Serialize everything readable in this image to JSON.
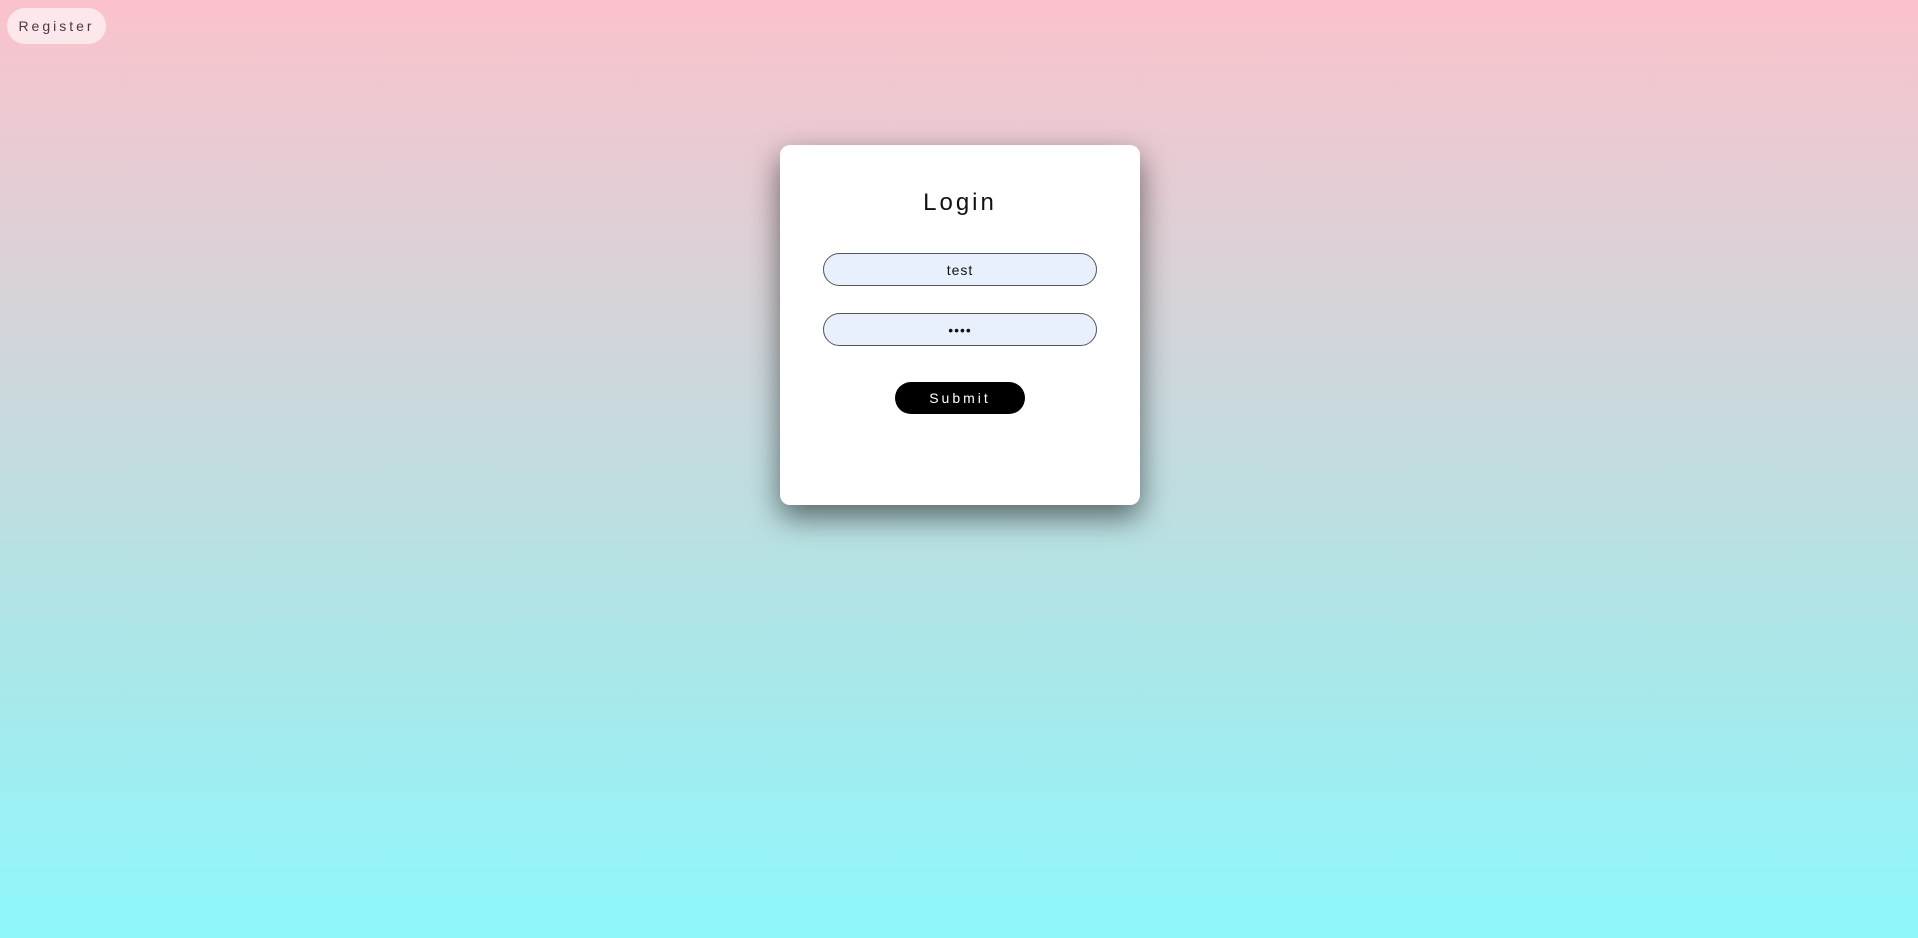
{
  "header": {
    "register_label": "Register"
  },
  "login": {
    "title": "Login",
    "username_value": "test",
    "password_value": "test",
    "submit_label": "Submit"
  },
  "colors": {
    "gradient_top": "#fbc2cc",
    "gradient_bottom": "#8ef7fb",
    "card_background": "#ffffff",
    "input_background": "#e8f0fe",
    "submit_background": "#000000"
  }
}
